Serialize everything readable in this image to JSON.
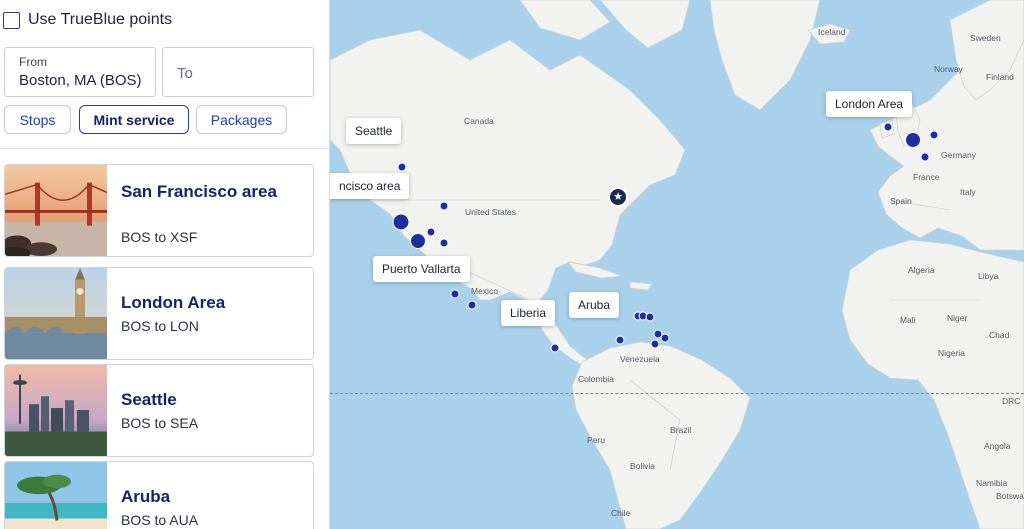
{
  "panel": {
    "points_label": "Use TrueBlue points",
    "from": {
      "label": "From",
      "value": "Boston, MA (BOS)"
    },
    "to": {
      "placeholder": "To"
    },
    "filters": [
      "Stops",
      "Mint service",
      "Packages"
    ],
    "destinations": [
      {
        "name": "San Francisco area",
        "route": "BOS to XSF"
      },
      {
        "name": "London Area",
        "route": "BOS to LON"
      },
      {
        "name": "Seattle",
        "route": "BOS to SEA"
      },
      {
        "name": "Aruba",
        "route": "BOS to AUA"
      }
    ]
  },
  "map": {
    "callouts": [
      "Seattle",
      "ncisco area",
      "Puerto Vallarta",
      "Liberia",
      "Aruba",
      "London Area"
    ],
    "places": [
      "Iceland",
      "Sweden",
      "Norway",
      "Finland",
      "Canada",
      "United States",
      "Mexico",
      "Venezuela",
      "Colombia",
      "Peru",
      "Brazil",
      "Bolivia",
      "Chile",
      "Germany",
      "France",
      "Spain",
      "Italy",
      "Algeria",
      "Libya",
      "Mali",
      "Niger",
      "Nigeria",
      "Chad",
      "DRC",
      "Angola",
      "Namibia",
      "Botswana"
    ],
    "origin_symbol": "★",
    "colors": {
      "water": "#a9d1ec",
      "land": "#f2f2f0",
      "dot": "#1d2f9e",
      "brand": "#14236b"
    }
  }
}
